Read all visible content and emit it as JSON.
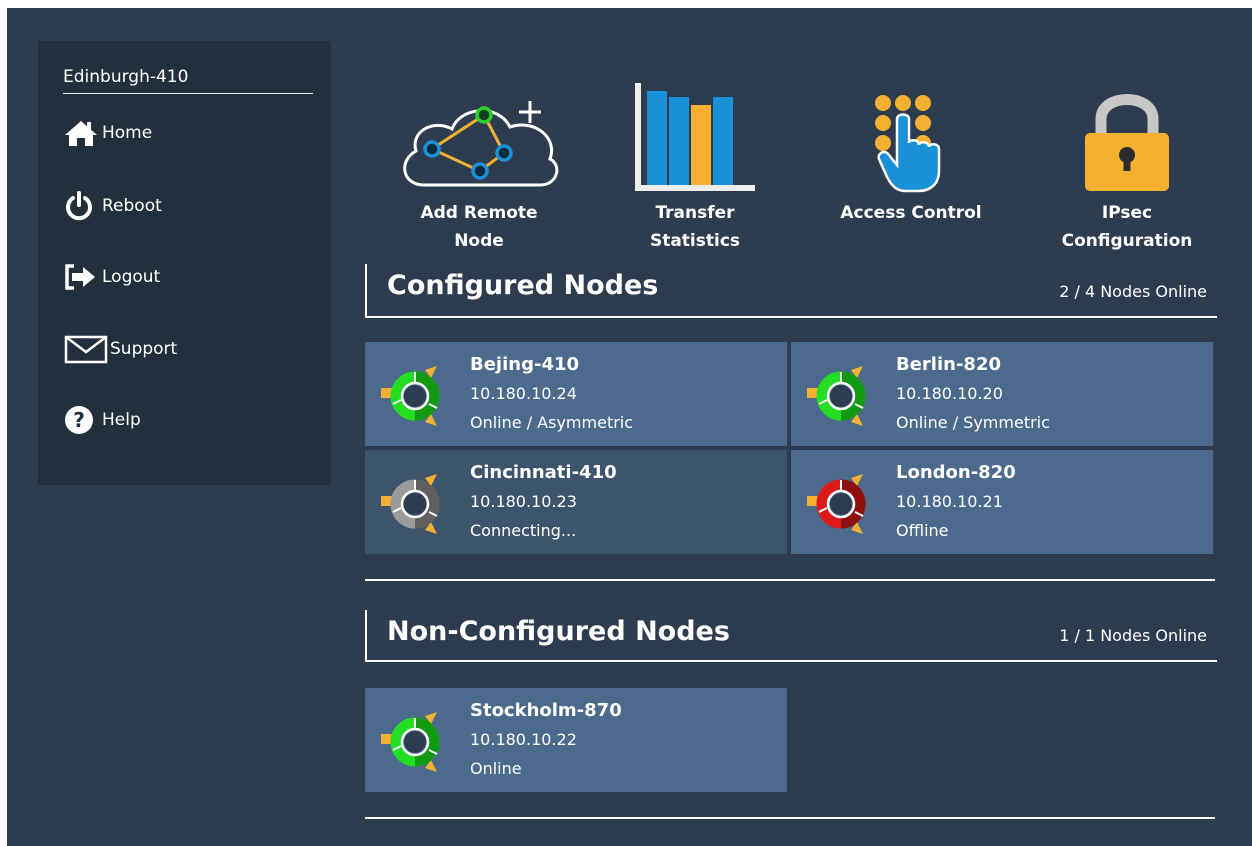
{
  "sidebar": {
    "device_name": "Edinburgh-410",
    "items": [
      {
        "label": "Home",
        "icon": "home-icon"
      },
      {
        "label": "Reboot",
        "icon": "power-icon"
      },
      {
        "label": "Logout",
        "icon": "logout-icon"
      },
      {
        "label": "Support",
        "icon": "envelope-icon"
      },
      {
        "label": "Help",
        "icon": "help-icon"
      }
    ]
  },
  "toolbar": {
    "tools": [
      {
        "label_line1": "Add Remote",
        "label_line2": "Node",
        "icon": "cloud-network-add-icon"
      },
      {
        "label_line1": "Transfer",
        "label_line2": "Statistics",
        "icon": "bar-chart-icon"
      },
      {
        "label_line1": "Access Control",
        "label_line2": "",
        "icon": "keypad-touch-icon"
      },
      {
        "label_line1": "IPsec",
        "label_line2": "Configuration",
        "icon": "padlock-icon"
      }
    ]
  },
  "configured": {
    "title": "Configured Nodes",
    "count": "2 / 4 Nodes Online",
    "nodes": [
      {
        "name": "Bejing-410",
        "ip": "10.180.10.24",
        "status": "Online / Asymmetric",
        "state": "online"
      },
      {
        "name": "Berlin-820",
        "ip": "10.180.10.20",
        "status": "Online / Symmetric",
        "state": "online"
      },
      {
        "name": "Cincinnati-410",
        "ip": "10.180.10.23",
        "status": "Connecting...",
        "state": "connecting"
      },
      {
        "name": "London-820",
        "ip": "10.180.10.21",
        "status": "Offline",
        "state": "offline"
      }
    ]
  },
  "nonconfigured": {
    "title": "Non-Configured Nodes",
    "count": "1 / 1 Nodes Online",
    "nodes": [
      {
        "name": "Stockholm-870",
        "ip": "10.180.10.22",
        "status": "Online",
        "state": "online"
      }
    ]
  },
  "colors": {
    "background": "#2d3c4f",
    "sidebar": "#222f3d",
    "card": "#4c6a8b",
    "card_dim": "#3d546d",
    "online": "#22dd22",
    "offline": "#cc1a1a",
    "connecting": "#8a8a8a",
    "accent_orange": "#f4b131",
    "accent_blue": "#1a90d8"
  }
}
